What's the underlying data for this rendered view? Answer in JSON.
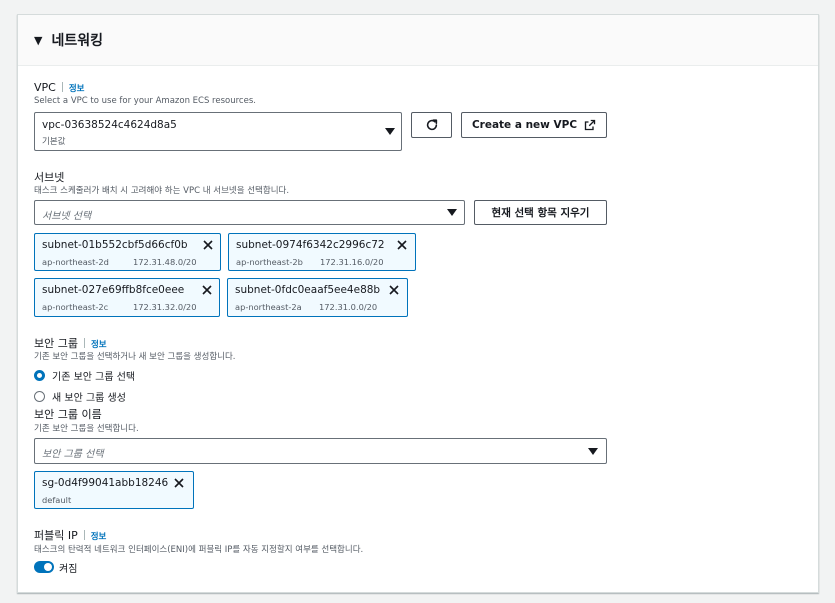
{
  "section": {
    "title": "네트워킹"
  },
  "vpc": {
    "label": "VPC",
    "info": "정보",
    "description": "Select a VPC to use for your Amazon ECS resources.",
    "selected_value": "vpc-03638524c4624d8a5",
    "selected_sub": "기본값",
    "create_button": "Create a new VPC"
  },
  "subnets": {
    "label": "서브넷",
    "description": "태스크 스케줄러가 배치 시 고려해야 하는 VPC 내 서브넷을 선택합니다.",
    "placeholder": "서브넷 선택",
    "clear_button": "현재 선택 항목 지우기",
    "tokens": [
      {
        "name": "subnet-01b552cbf5d66cf0b",
        "zone": "ap-northeast-2d",
        "cidr": "172.31.48.0/20"
      },
      {
        "name": "subnet-0974f6342c2996c72",
        "zone": "ap-northeast-2b",
        "cidr": "172.31.16.0/20"
      },
      {
        "name": "subnet-027e69ffb8fce0eee",
        "zone": "ap-northeast-2c",
        "cidr": "172.31.32.0/20"
      },
      {
        "name": "subnet-0fdc0eaaf5ee4e88b",
        "zone": "ap-northeast-2a",
        "cidr": "172.31.0.0/20"
      }
    ]
  },
  "security_group": {
    "label": "보안 그룹",
    "info": "정보",
    "description": "기존 보안 그룹을 선택하거나 새 보안 그룹을 생성합니다.",
    "options": [
      {
        "label": "기존 보안 그룹 선택",
        "selected": true
      },
      {
        "label": "새 보안 그룹 생성",
        "selected": false
      }
    ],
    "name_label": "보안 그룹 이름",
    "name_description": "기존 보안 그룹을 선택합니다.",
    "placeholder": "보안 그룹 선택",
    "token": {
      "name": "sg-0d4f99041abb18246",
      "sub": "default"
    }
  },
  "public_ip": {
    "label": "퍼블릭 IP",
    "info": "정보",
    "description": "태스크의 탄력적 네트워크 인터페이스(ENI)에 퍼블릭 IP를 자동 지정할지 여부를 선택합니다.",
    "toggle_label": "켜짐",
    "enabled": true
  },
  "colors": {
    "accent": "#0073bb",
    "token_bg": "#f1faff",
    "text": "#16191f",
    "muted": "#545b64"
  },
  "icons": [
    "caret-down-icon",
    "refresh-icon",
    "external-link-icon",
    "dropdown-arrow-icon",
    "close-icon"
  ]
}
